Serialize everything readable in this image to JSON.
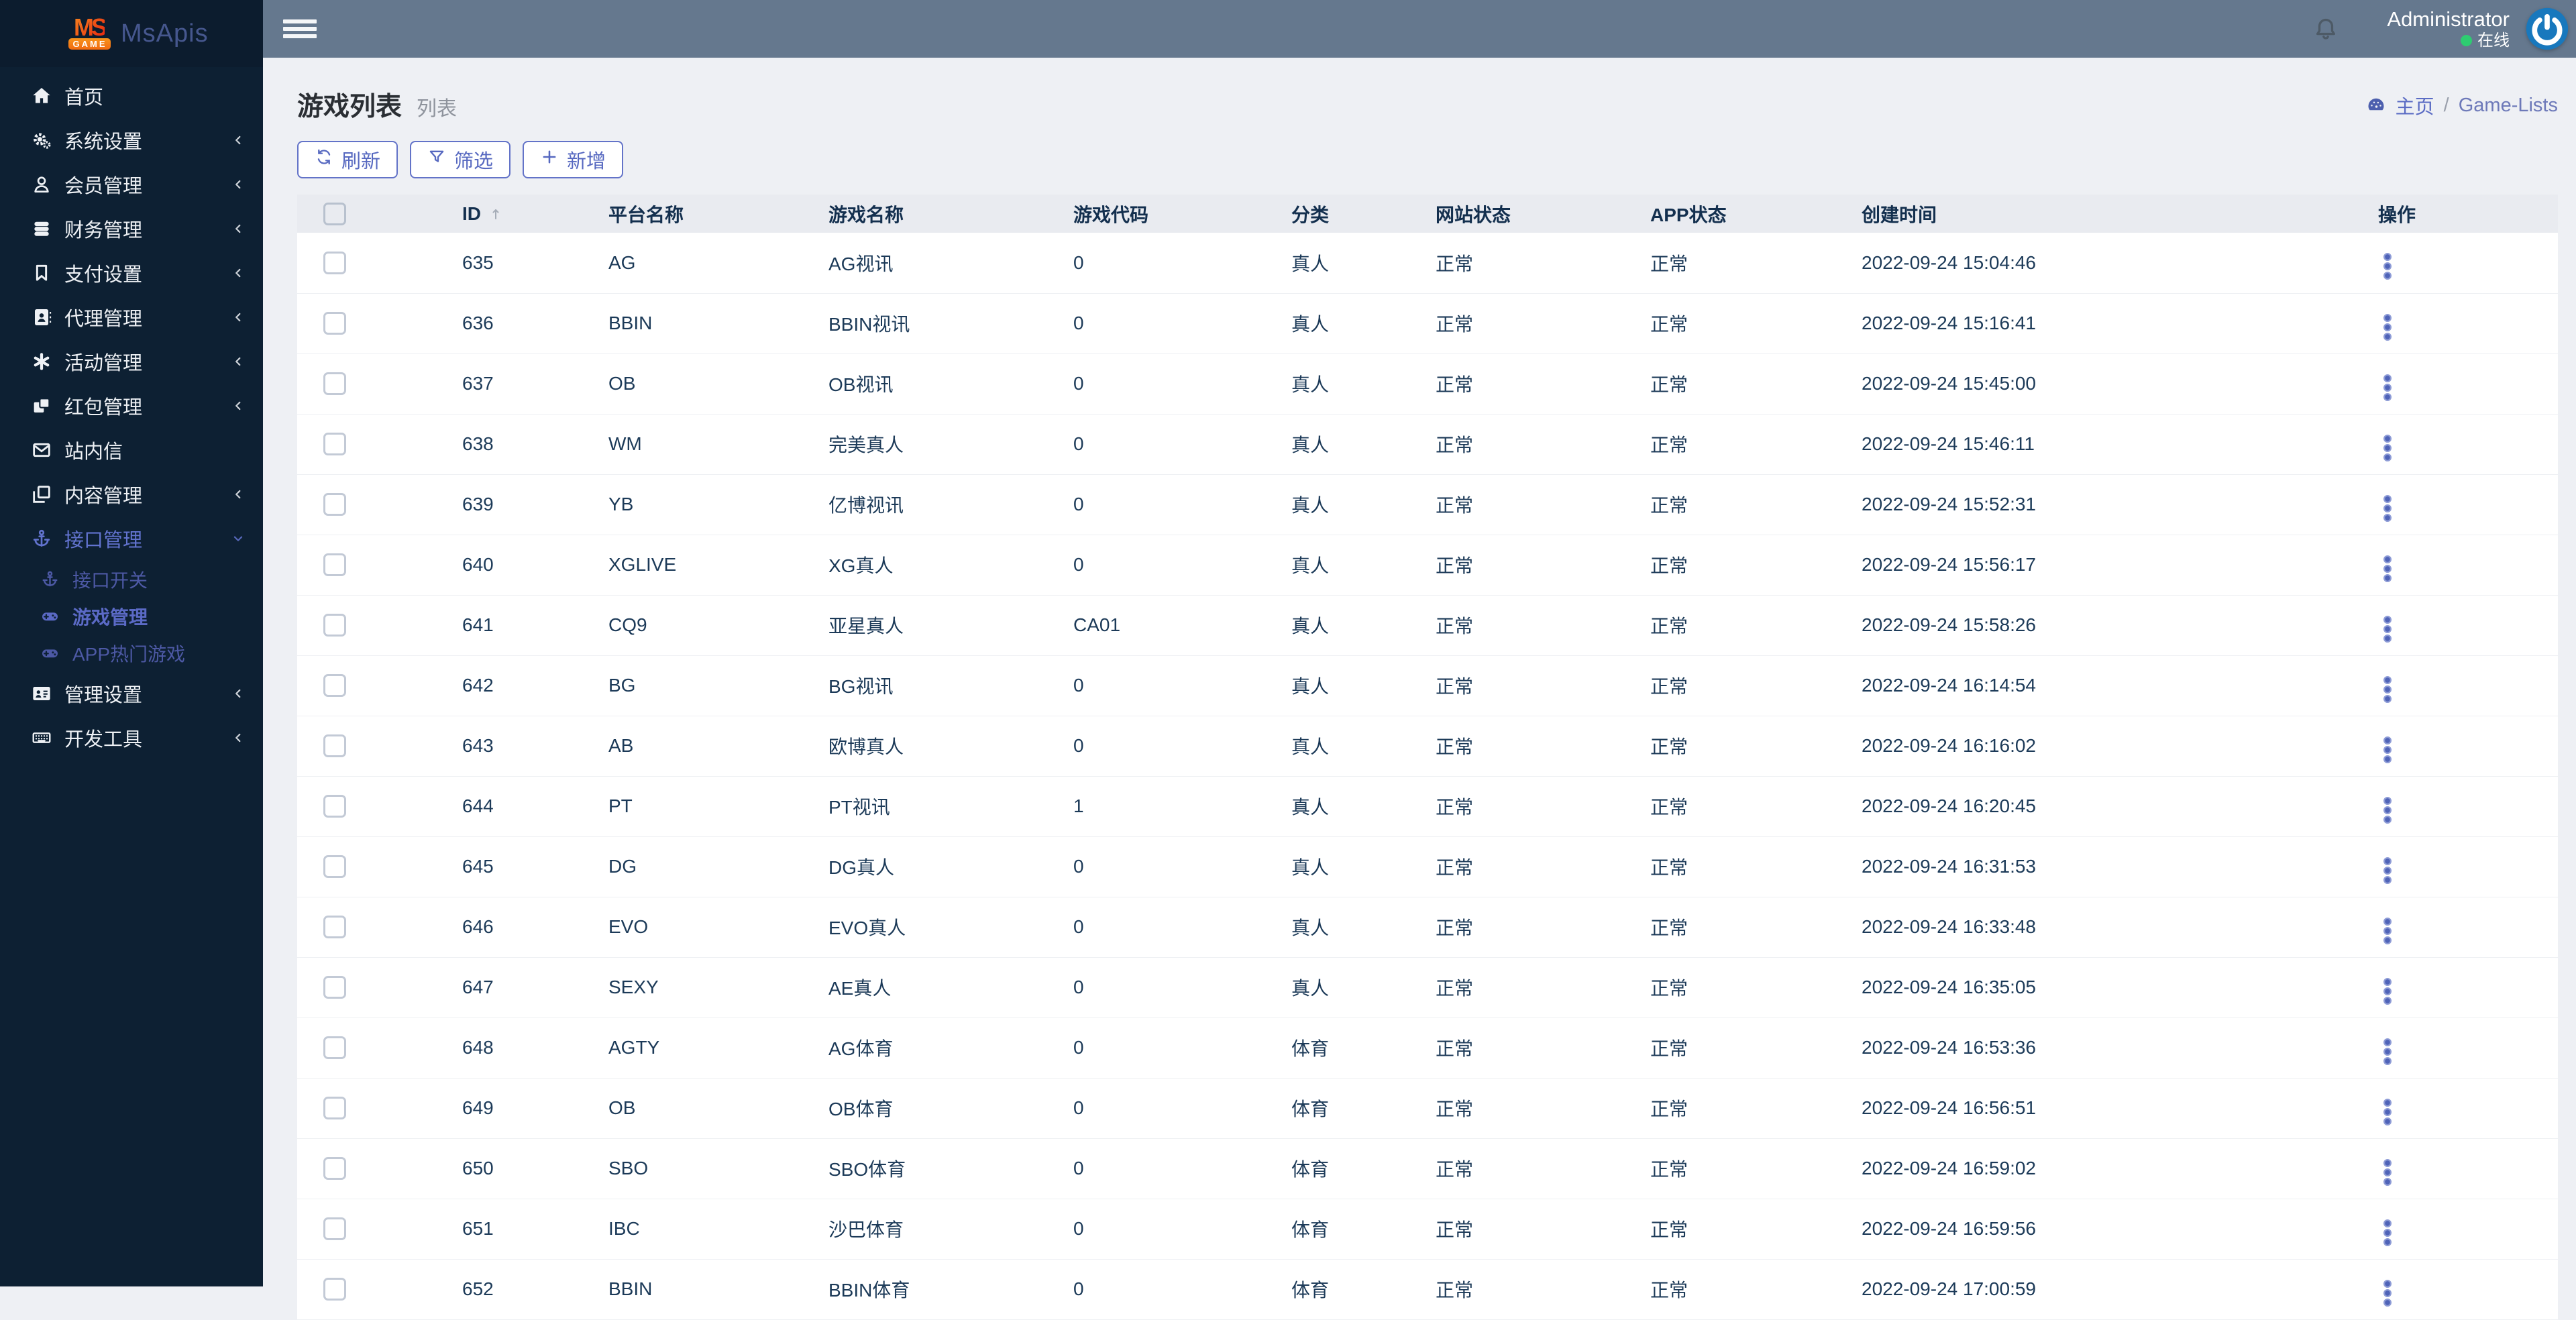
{
  "colors": {
    "accent": "#5b6ac6",
    "sidebar_bg": "#0d2033",
    "topbar_bg": "#65788e",
    "online_green": "#2ecc71",
    "logo_orange": "#f5821f",
    "logo_red": "#e8260f",
    "table_text": "#1c3a58",
    "power_blue": "#1878bd"
  },
  "brand": {
    "logo_ms": "MS",
    "logo_game": "GAME",
    "app_name": "MsApis"
  },
  "sidebar": {
    "items": [
      {
        "key": "home",
        "label": "首页",
        "icon": "home-icon",
        "chevron": ""
      },
      {
        "key": "system-settings",
        "label": "系统设置",
        "icon": "gears-icon",
        "chevron": "left"
      },
      {
        "key": "member-management",
        "label": "会员管理",
        "icon": "user-icon",
        "chevron": "left"
      },
      {
        "key": "finance-management",
        "label": "财务管理",
        "icon": "database-icon",
        "chevron": "left"
      },
      {
        "key": "payment-settings",
        "label": "支付设置",
        "icon": "bookmark-icon",
        "chevron": "left"
      },
      {
        "key": "agent-management",
        "label": "代理管理",
        "icon": "address-book-icon",
        "chevron": "left"
      },
      {
        "key": "activity-management",
        "label": "活动管理",
        "icon": "asterisk-icon",
        "chevron": "left"
      },
      {
        "key": "red-packet-management",
        "label": "红包管理",
        "icon": "red-packet-icon",
        "chevron": "left"
      },
      {
        "key": "site-mail",
        "label": "站内信",
        "icon": "envelope-icon",
        "chevron": ""
      },
      {
        "key": "content-management",
        "label": "内容管理",
        "icon": "copy-icon",
        "chevron": "left"
      },
      {
        "key": "api-management",
        "label": "接口管理",
        "icon": "anchor-icon",
        "chevron": "down",
        "state": "expanded"
      },
      {
        "key": "api-switch",
        "label": "接口开关",
        "icon": "anchor-icon",
        "chevron": "",
        "state": "sub"
      },
      {
        "key": "game-management",
        "label": "游戏管理",
        "icon": "gamepad-icon",
        "chevron": "",
        "state": "sub-active"
      },
      {
        "key": "app-hot-games",
        "label": "APP热门游戏",
        "icon": "gamepad-icon",
        "chevron": "",
        "state": "sub"
      },
      {
        "key": "admin-settings",
        "label": "管理设置",
        "icon": "id-card-icon",
        "chevron": "left"
      },
      {
        "key": "dev-tools",
        "label": "开发工具",
        "icon": "keyboard-icon",
        "chevron": "left"
      }
    ]
  },
  "header": {
    "user_name": "Administrator",
    "user_status": "在线"
  },
  "page": {
    "title": "游戏列表",
    "subtitle": "列表",
    "breadcrumb_home": "主页",
    "breadcrumb_sep": "/",
    "breadcrumb_current": "Game-Lists"
  },
  "toolbar": {
    "refresh_label": "刷新",
    "filter_label": "筛选",
    "add_label": "新增"
  },
  "table": {
    "columns": [
      "ID",
      "平台名称",
      "游戏名称",
      "游戏代码",
      "分类",
      "网站状态",
      "APP状态",
      "创建时间",
      "操作"
    ],
    "rows": [
      {
        "id": "635",
        "platform": "AG",
        "game": "AG视讯",
        "code": "0",
        "category": "真人",
        "site_status": "正常",
        "app_status": "正常",
        "created": "2022-09-24 15:04:46"
      },
      {
        "id": "636",
        "platform": "BBIN",
        "game": "BBIN视讯",
        "code": "0",
        "category": "真人",
        "site_status": "正常",
        "app_status": "正常",
        "created": "2022-09-24 15:16:41"
      },
      {
        "id": "637",
        "platform": "OB",
        "game": "OB视讯",
        "code": "0",
        "category": "真人",
        "site_status": "正常",
        "app_status": "正常",
        "created": "2022-09-24 15:45:00"
      },
      {
        "id": "638",
        "platform": "WM",
        "game": "完美真人",
        "code": "0",
        "category": "真人",
        "site_status": "正常",
        "app_status": "正常",
        "created": "2022-09-24 15:46:11"
      },
      {
        "id": "639",
        "platform": "YB",
        "game": "亿博视讯",
        "code": "0",
        "category": "真人",
        "site_status": "正常",
        "app_status": "正常",
        "created": "2022-09-24 15:52:31"
      },
      {
        "id": "640",
        "platform": "XGLIVE",
        "game": "XG真人",
        "code": "0",
        "category": "真人",
        "site_status": "正常",
        "app_status": "正常",
        "created": "2022-09-24 15:56:17"
      },
      {
        "id": "641",
        "platform": "CQ9",
        "game": "亚星真人",
        "code": "CA01",
        "category": "真人",
        "site_status": "正常",
        "app_status": "正常",
        "created": "2022-09-24 15:58:26"
      },
      {
        "id": "642",
        "platform": "BG",
        "game": "BG视讯",
        "code": "0",
        "category": "真人",
        "site_status": "正常",
        "app_status": "正常",
        "created": "2022-09-24 16:14:54"
      },
      {
        "id": "643",
        "platform": "AB",
        "game": "欧博真人",
        "code": "0",
        "category": "真人",
        "site_status": "正常",
        "app_status": "正常",
        "created": "2022-09-24 16:16:02"
      },
      {
        "id": "644",
        "platform": "PT",
        "game": "PT视讯",
        "code": "1",
        "category": "真人",
        "site_status": "正常",
        "app_status": "正常",
        "created": "2022-09-24 16:20:45"
      },
      {
        "id": "645",
        "platform": "DG",
        "game": "DG真人",
        "code": "0",
        "category": "真人",
        "site_status": "正常",
        "app_status": "正常",
        "created": "2022-09-24 16:31:53"
      },
      {
        "id": "646",
        "platform": "EVO",
        "game": "EVO真人",
        "code": "0",
        "category": "真人",
        "site_status": "正常",
        "app_status": "正常",
        "created": "2022-09-24 16:33:48"
      },
      {
        "id": "647",
        "platform": "SEXY",
        "game": "AE真人",
        "code": "0",
        "category": "真人",
        "site_status": "正常",
        "app_status": "正常",
        "created": "2022-09-24 16:35:05"
      },
      {
        "id": "648",
        "platform": "AGTY",
        "game": "AG体育",
        "code": "0",
        "category": "体育",
        "site_status": "正常",
        "app_status": "正常",
        "created": "2022-09-24 16:53:36"
      },
      {
        "id": "649",
        "platform": "OB",
        "game": "OB体育",
        "code": "0",
        "category": "体育",
        "site_status": "正常",
        "app_status": "正常",
        "created": "2022-09-24 16:56:51"
      },
      {
        "id": "650",
        "platform": "SBO",
        "game": "SBO体育",
        "code": "0",
        "category": "体育",
        "site_status": "正常",
        "app_status": "正常",
        "created": "2022-09-24 16:59:02"
      },
      {
        "id": "651",
        "platform": "IBC",
        "game": "沙巴体育",
        "code": "0",
        "category": "体育",
        "site_status": "正常",
        "app_status": "正常",
        "created": "2022-09-24 16:59:56"
      },
      {
        "id": "652",
        "platform": "BBIN",
        "game": "BBIN体育",
        "code": "0",
        "category": "体育",
        "site_status": "正常",
        "app_status": "正常",
        "created": "2022-09-24 17:00:59"
      }
    ]
  }
}
